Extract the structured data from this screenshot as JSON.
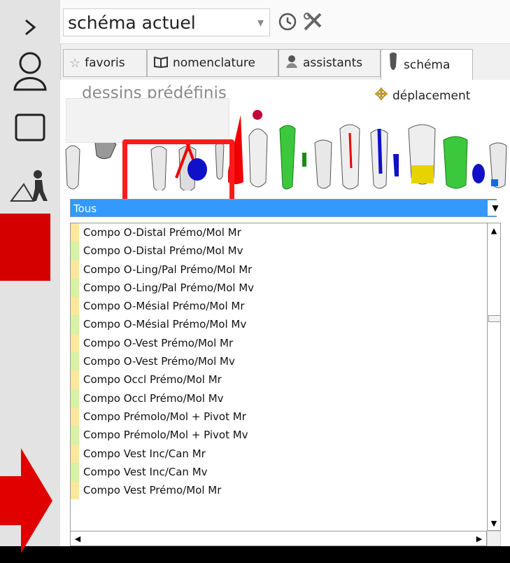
{
  "topbar": {
    "scheme_select_value": "schéma actuel",
    "history_icon": "history-icon",
    "tools_icon": "tools-icon"
  },
  "tabs": [
    {
      "label": "favoris",
      "icon": "star-icon"
    },
    {
      "label": "nomenclature",
      "icon": "book-icon"
    },
    {
      "label": "assistants",
      "icon": "assistant-icon"
    },
    {
      "label": "schéma",
      "icon": "tooth-icon"
    }
  ],
  "predefined": {
    "title": "dessins prédéfinis",
    "move_label": "déplacement"
  },
  "filter": {
    "selected": "Tous"
  },
  "list_items": [
    "Compo O-Distal Prémo/Mol Mr",
    "Compo O-Distal Prémo/Mol Mv",
    "Compo O-Ling/Pal Prémo/Mol Mr",
    "Compo O-Ling/Pal Prémo/Mol Mv",
    "Compo O-Mésial Prémo/Mol Mr",
    "Compo O-Mésial Prémo/Mol Mv",
    "Compo O-Vest Prémo/Mol Mr",
    "Compo O-Vest Prémo/Mol Mv",
    "Compo Occl Prémo/Mol Mr",
    "Compo Occl Prémo/Mol Mv",
    "Compo Prémolo/Mol + Pivot Mr",
    "Compo Prémolo/Mol + Pivot Mv",
    "Compo Vest Inc/Can Mr",
    "Compo Vest Inc/Can Mv",
    "Compo Vest Prémo/Mol Mr"
  ],
  "colors": {
    "accent": "#3399ff",
    "highlight": "#ff1a1a",
    "stripe_yellow": "#fde79a",
    "stripe_green": "#d6f2a3"
  }
}
